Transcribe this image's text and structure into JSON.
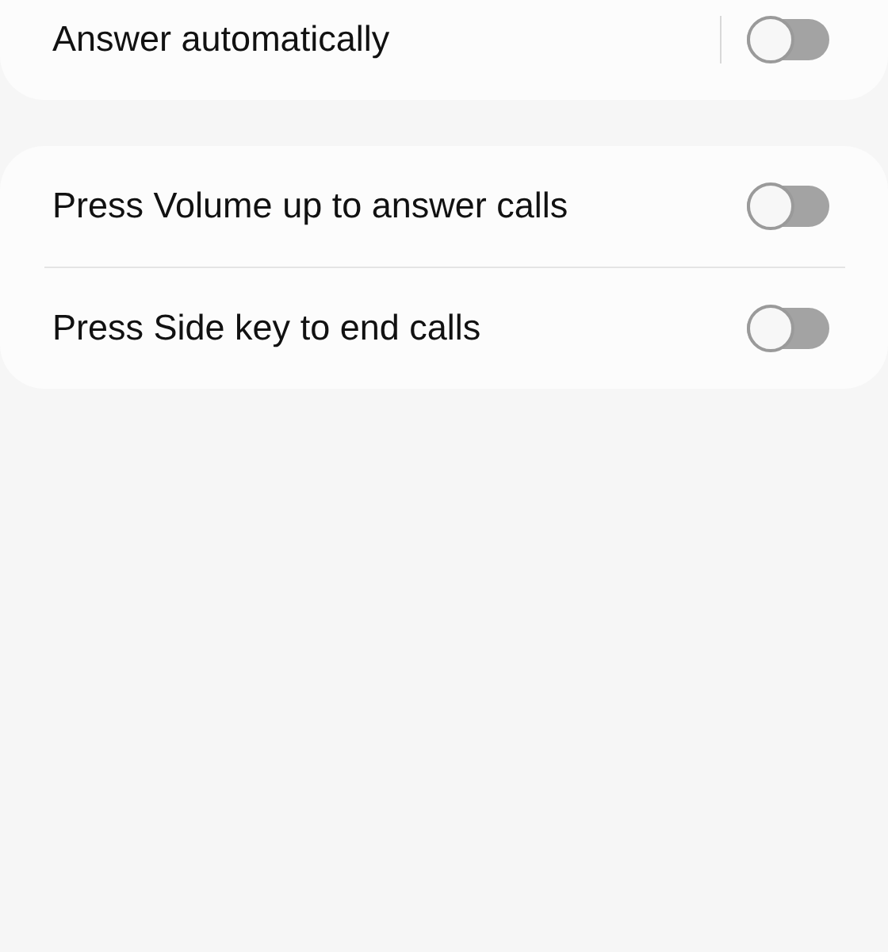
{
  "cards": [
    {
      "rows": [
        {
          "label": "Answer automatically",
          "on": false,
          "split": true
        }
      ]
    },
    {
      "rows": [
        {
          "label": "Press Volume up to answer calls",
          "on": false,
          "split": false
        },
        {
          "label": "Press Side key to end calls",
          "on": false,
          "split": false
        }
      ]
    }
  ]
}
